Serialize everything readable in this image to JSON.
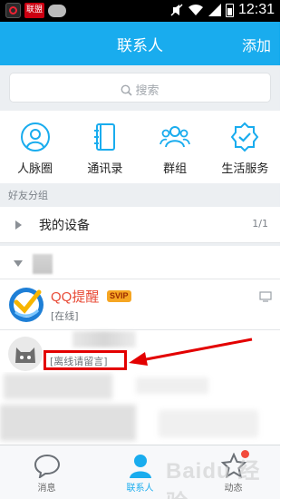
{
  "status_bar": {
    "app_badge_text": "联盟",
    "time": "12:31",
    "icons": [
      "qq-notify-icon",
      "game-icon",
      "cat-icon",
      "mute-icon",
      "wifi-icon",
      "signal-icon",
      "battery-icon"
    ]
  },
  "header": {
    "title": "联系人",
    "add_label": "添加",
    "background": "#19acee"
  },
  "search": {
    "placeholder": "搜索"
  },
  "quick_entries": [
    {
      "label": "人脉圈",
      "icon": "person-circle-icon"
    },
    {
      "label": "通讯录",
      "icon": "address-book-icon"
    },
    {
      "label": "群组",
      "icon": "group-icon"
    },
    {
      "label": "生活服务",
      "icon": "service-shield-icon"
    }
  ],
  "friends": {
    "group_header": "好友分组",
    "my_devices": {
      "label": "我的设备",
      "count": "1/1"
    },
    "qq_reminder": {
      "name": "QQ提醒",
      "badge": "SVIP",
      "status": "[在线]"
    },
    "friend_status": "[离线请留言]"
  },
  "tabbar": {
    "tabs": [
      {
        "label": "消息",
        "icon": "message-bubble-icon",
        "active": false
      },
      {
        "label": "联系人",
        "icon": "contacts-person-icon",
        "active": true
      },
      {
        "label": "动态",
        "icon": "star-dynamic-icon",
        "active": false,
        "has_badge": true
      }
    ]
  },
  "watermark": "Baidu 经验",
  "accent_colors": {
    "primary": "#19acee",
    "highlight_box": "#e30000",
    "qq_name": "#e84b37"
  }
}
